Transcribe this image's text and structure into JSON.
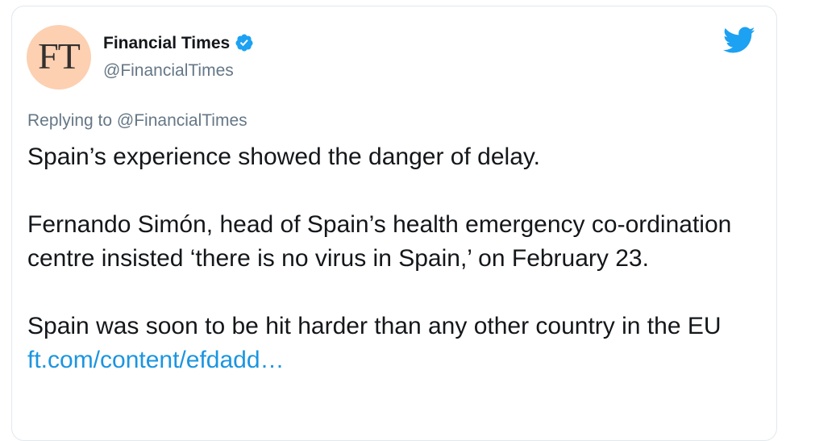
{
  "tweet": {
    "author": {
      "avatar_text": "FT",
      "display_name": "Financial Times",
      "handle": "@FinancialTimes",
      "verified_icon": "verified-badge-icon"
    },
    "platform_icon": "twitter-bird-icon",
    "replying_to": "Replying to @FinancialTimes",
    "paragraphs": [
      "Spain’s experience showed the danger of delay.",
      "Fernando Simón, head of Spain’s health emergency co-ordination centre insisted ‘there is no virus in Spain,’ on February 23.",
      "Spain was soon to be hit harder than any other country in the EU"
    ],
    "link_text": "ft.com/content/efdadd…"
  },
  "colors": {
    "primary_text": "#14171a",
    "secondary_text": "#657786",
    "link": "#1b95e0",
    "brand_blue": "#1da1f2",
    "avatar_bg": "#fcd0b1"
  }
}
